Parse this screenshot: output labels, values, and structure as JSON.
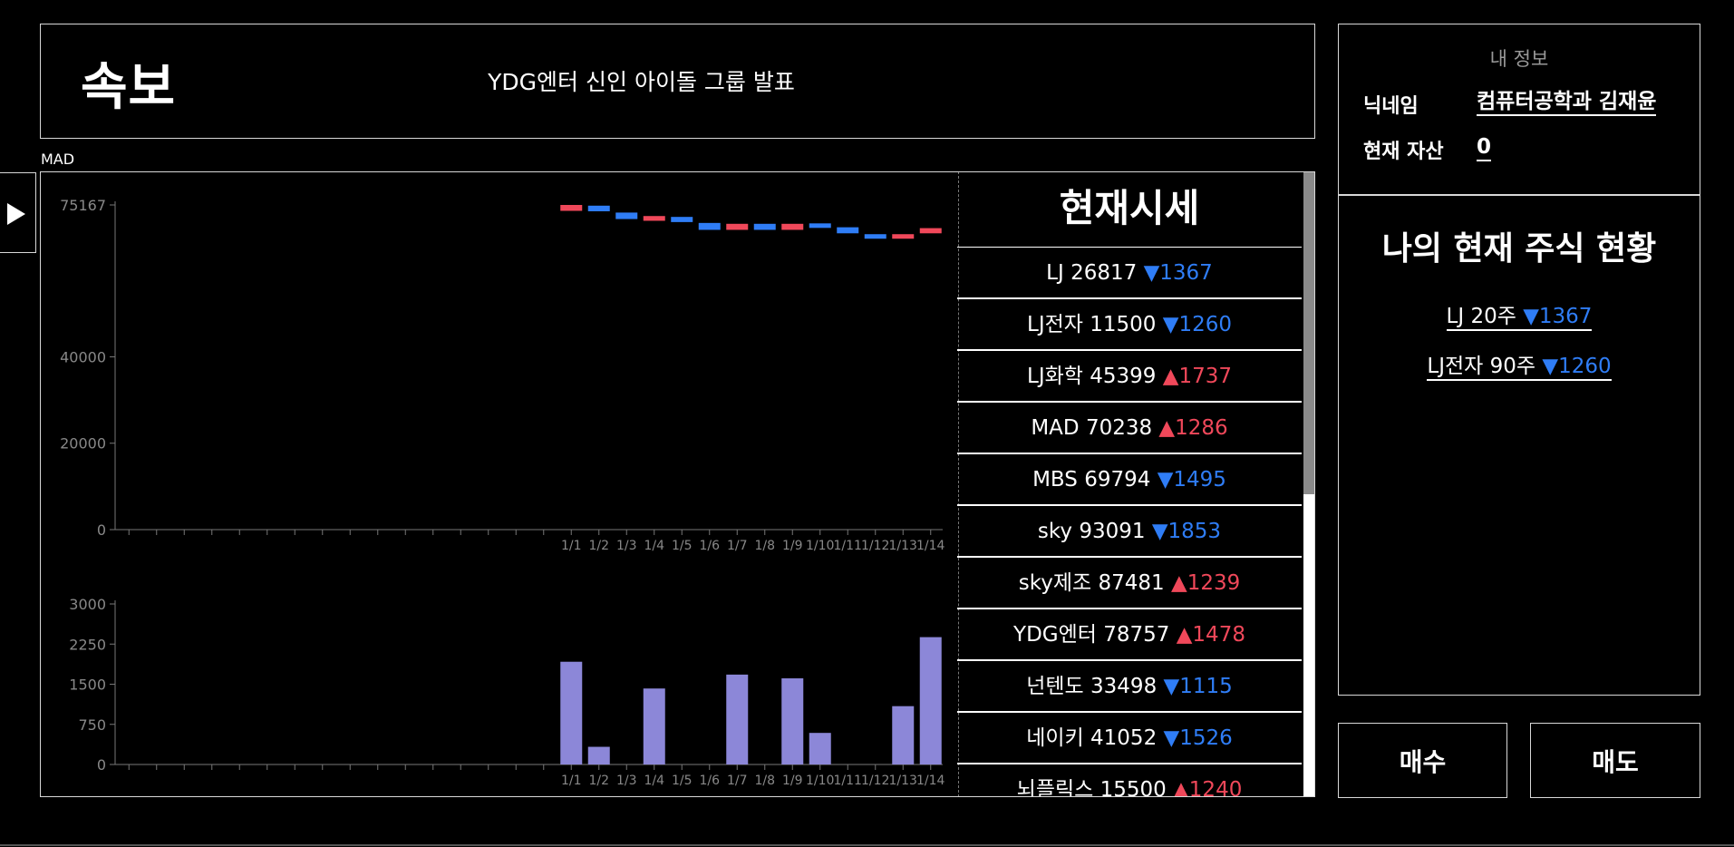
{
  "news": {
    "label": "속보",
    "headline": "YDG엔터 신인 아이돌 그룹 발표"
  },
  "selected_stock": "MAD",
  "prices": {
    "title": "현재시세",
    "items": [
      {
        "name": "LJ",
        "price": "26817",
        "dir": "down",
        "change": "1367"
      },
      {
        "name": "LJ전자",
        "price": "11500",
        "dir": "down",
        "change": "1260"
      },
      {
        "name": "LJ화학",
        "price": "45399",
        "dir": "up",
        "change": "1737"
      },
      {
        "name": "MAD",
        "price": "70238",
        "dir": "up",
        "change": "1286"
      },
      {
        "name": "MBS",
        "price": "69794",
        "dir": "down",
        "change": "1495"
      },
      {
        "name": "sky",
        "price": "93091",
        "dir": "down",
        "change": "1853"
      },
      {
        "name": "sky제조",
        "price": "87481",
        "dir": "up",
        "change": "1239"
      },
      {
        "name": "YDG엔터",
        "price": "78757",
        "dir": "up",
        "change": "1478"
      },
      {
        "name": "넌텐도",
        "price": "33498",
        "dir": "down",
        "change": "1115"
      },
      {
        "name": "네이키",
        "price": "41052",
        "dir": "down",
        "change": "1526"
      },
      {
        "name": "뇌플릭스",
        "price": "15500",
        "dir": "up",
        "change": "1240"
      }
    ]
  },
  "my_info": {
    "title": "내 정보",
    "nickname_label": "닉네임",
    "nickname": "컴퓨터공학과 김재윤",
    "assets_label": "현재 자산",
    "assets": "0"
  },
  "holdings": {
    "title": "나의 현재 주식 현황",
    "items": [
      {
        "name": "LJ",
        "qty": "20주",
        "dir": "down",
        "change": "1367"
      },
      {
        "name": "LJ전자",
        "qty": "90주",
        "dir": "down",
        "change": "1260"
      }
    ]
  },
  "buttons": {
    "buy": "매수",
    "sell": "매도"
  },
  "colors": {
    "up": "#f0485a",
    "down": "#2f7df6",
    "volume": "#8c87d8"
  },
  "icons": {
    "play": "play-icon",
    "up": "▲",
    "down": "▼"
  },
  "chart_data": [
    {
      "type": "candlestick",
      "categories": [
        "1/1",
        "1/2",
        "1/3",
        "1/4",
        "1/5",
        "1/6",
        "1/7",
        "1/8",
        "1/9",
        "1/10",
        "1/11",
        "1/12",
        "1/13",
        "1/14"
      ],
      "y_ticks": [
        0,
        20000,
        40000,
        75167
      ],
      "ylim": [
        0,
        75167
      ],
      "series": [
        {
          "open": 75167,
          "close": 73800,
          "dir": "up"
        },
        {
          "open": 75000,
          "close": 73700,
          "dir": "down"
        },
        {
          "open": 73400,
          "close": 71900,
          "dir": "down"
        },
        {
          "open": 72600,
          "close": 71500,
          "dir": "up"
        },
        {
          "open": 72400,
          "close": 71200,
          "dir": "down"
        },
        {
          "open": 71000,
          "close": 69400,
          "dir": "down"
        },
        {
          "open": 70800,
          "close": 69400,
          "dir": "up"
        },
        {
          "open": 70800,
          "close": 69400,
          "dir": "down"
        },
        {
          "open": 70800,
          "close": 69400,
          "dir": "up"
        },
        {
          "open": 70900,
          "close": 70000,
          "dir": "down"
        },
        {
          "open": 70000,
          "close": 68600,
          "dir": "down"
        },
        {
          "open": 68400,
          "close": 67400,
          "dir": "down"
        },
        {
          "open": 68400,
          "close": 67400,
          "dir": "up"
        },
        {
          "open": 69800,
          "close": 68600,
          "dir": "up"
        }
      ]
    },
    {
      "type": "bar",
      "categories": [
        "1/1",
        "1/2",
        "1/3",
        "1/4",
        "1/5",
        "1/6",
        "1/7",
        "1/8",
        "1/9",
        "1/10",
        "1/11",
        "1/12",
        "1/13",
        "1/14"
      ],
      "values": [
        1920,
        330,
        0,
        1420,
        0,
        0,
        1680,
        0,
        1610,
        590,
        0,
        0,
        1090,
        2380
      ],
      "y_ticks": [
        0,
        750,
        1500,
        2250,
        3000
      ],
      "ylim": [
        0,
        3000
      ]
    }
  ]
}
